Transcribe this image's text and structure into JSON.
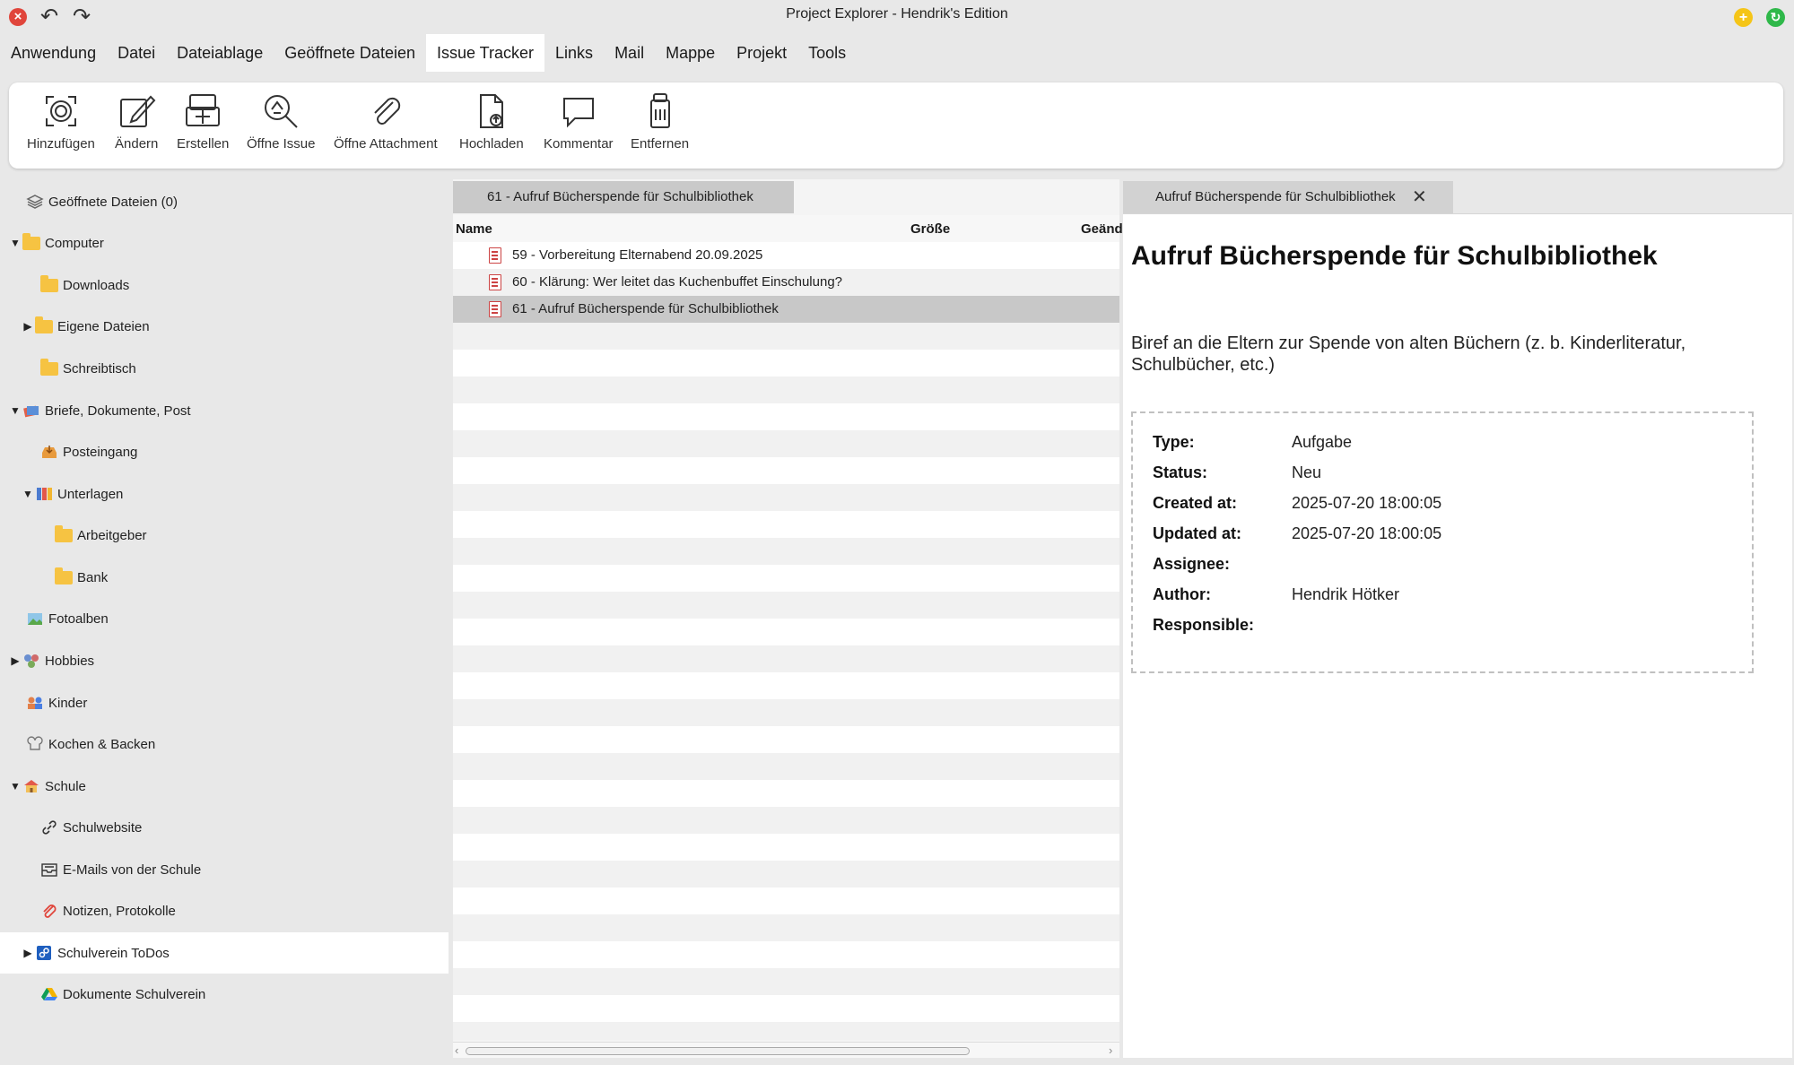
{
  "window": {
    "title": "Project Explorer - Hendrik's Edition"
  },
  "menu": [
    "Anwendung",
    "Datei",
    "Dateiablage",
    "Geöffnete Dateien",
    "Issue Tracker",
    "Links",
    "Mail",
    "Mappe",
    "Projekt",
    "Tools"
  ],
  "menu_active": "Issue Tracker",
  "toolbar": [
    {
      "label": "Hinzufügen",
      "icon": "add-icon"
    },
    {
      "label": "Ändern",
      "icon": "edit-icon"
    },
    {
      "label": "Erstellen",
      "icon": "create-icon"
    },
    {
      "label": "Öffne Issue",
      "icon": "open-issue-icon"
    },
    {
      "label": "Öffne Attachment",
      "icon": "paperclip-icon"
    },
    {
      "label": "Hochladen",
      "icon": "upload-icon"
    },
    {
      "label": "Kommentar",
      "icon": "comment-icon"
    },
    {
      "label": "Entfernen",
      "icon": "trash-icon"
    }
  ],
  "sidebar": {
    "items": [
      {
        "label": "Geöffnete Dateien (0)",
        "icon": "stack-icon",
        "expander": ""
      },
      {
        "label": "Computer",
        "icon": "folder-icon",
        "expander": "▼"
      },
      {
        "label": "Downloads",
        "icon": "folder-icon",
        "expander": ""
      },
      {
        "label": "Eigene Dateien",
        "icon": "folder-icon",
        "expander": "▶"
      },
      {
        "label": "Schreibtisch",
        "icon": "folder-icon",
        "expander": ""
      },
      {
        "label": "Briefe, Dokumente, Post",
        "icon": "letters-icon",
        "expander": "▼"
      },
      {
        "label": "Posteingang",
        "icon": "inbox-icon",
        "expander": ""
      },
      {
        "label": "Unterlagen",
        "icon": "binders-icon",
        "expander": "▼"
      },
      {
        "label": "Arbeitgeber",
        "icon": "folder-icon",
        "expander": ""
      },
      {
        "label": "Bank",
        "icon": "folder-icon",
        "expander": ""
      },
      {
        "label": "Fotoalben",
        "icon": "photo-icon",
        "expander": ""
      },
      {
        "label": "Hobbies",
        "icon": "hobbies-icon",
        "expander": "▶"
      },
      {
        "label": "Kinder",
        "icon": "kids-icon",
        "expander": ""
      },
      {
        "label": "Kochen & Backen",
        "icon": "cooking-icon",
        "expander": ""
      },
      {
        "label": "Schule",
        "icon": "school-icon",
        "expander": "▼"
      },
      {
        "label": "Schulwebsite",
        "icon": "link-icon",
        "expander": ""
      },
      {
        "label": "E-Mails von der Schule",
        "icon": "mail-icon",
        "expander": ""
      },
      {
        "label": "Notizen, Protokolle",
        "icon": "paperclip-icon",
        "expander": ""
      },
      {
        "label": "Schulverein ToDos",
        "icon": "issue-tracker-icon",
        "expander": "▶"
      },
      {
        "label": "Dokumente Schulverein",
        "icon": "drive-icon",
        "expander": ""
      }
    ],
    "selected": "Schulverein ToDos"
  },
  "filelist": {
    "tab": "61 - Aufruf Bücherspende für Schulbibliothek",
    "columns": [
      "Name",
      "Größe",
      "Geänd"
    ],
    "rows": [
      "59 - Vorbereitung Elternabend 20.09.2025",
      "60 - Klärung: Wer leitet das Kuchenbuffet Einschulung?",
      "61 - Aufruf Bücherspende für Schulbibliothek"
    ],
    "selected": "61 - Aufruf Bücherspende für Schulbibliothek"
  },
  "detail": {
    "tab": "Aufruf Bücherspende für Schulbibliothek",
    "title": "Aufruf Bücherspende für Schulbibliothek",
    "description": "Biref an die Eltern zur Spende von alten Büchern (z. b. Kinderliteratur, Schulbücher, etc.)",
    "properties": [
      {
        "key": "Type:",
        "value": "Aufgabe"
      },
      {
        "key": "Status:",
        "value": "Neu"
      },
      {
        "key": "Created at:",
        "value": "2025-07-20 18:00:05"
      },
      {
        "key": "Updated at:",
        "value": "2025-07-20 18:00:05"
      },
      {
        "key": "Assignee:",
        "value": ""
      },
      {
        "key": "Author:",
        "value": "Hendrik Hötker"
      },
      {
        "key": "Responsible:",
        "value": ""
      }
    ]
  }
}
